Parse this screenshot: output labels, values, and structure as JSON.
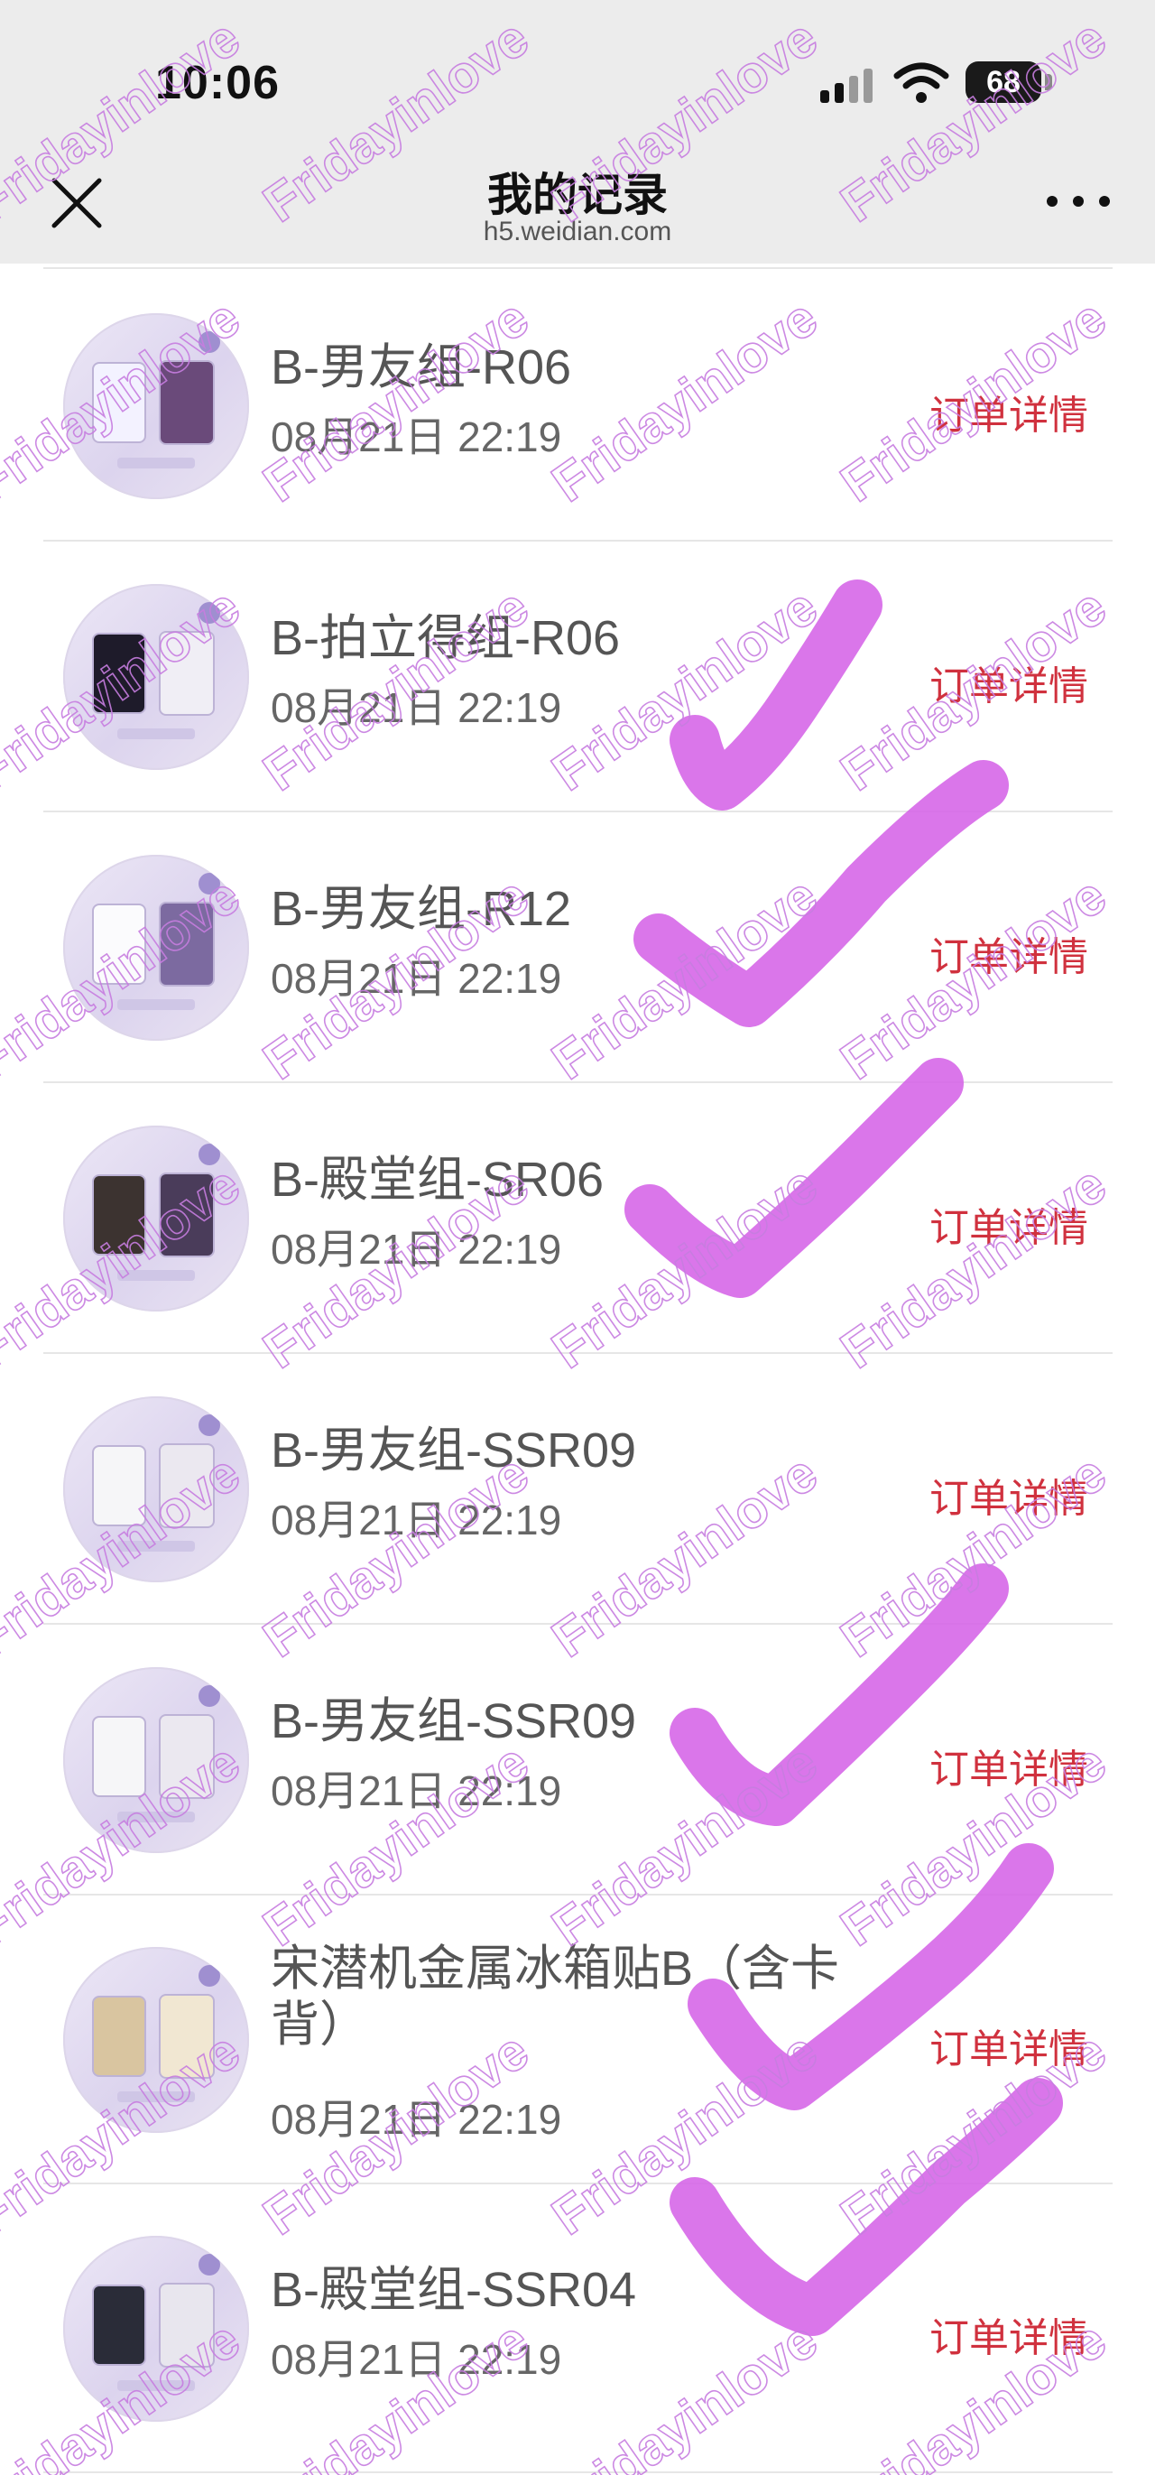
{
  "status_bar": {
    "time": "10:06",
    "battery_level": "68"
  },
  "nav": {
    "title": "我的记录",
    "subtitle": "h5.weidian.com"
  },
  "records": [
    {
      "name": "B-男友组-R06",
      "time": "08月21日 22:19",
      "action": "订单详情",
      "checked": false
    },
    {
      "name": "B-拍立得组-R06",
      "time": "08月21日 22:19",
      "action": "订单详情",
      "checked": true
    },
    {
      "name": "B-男友组-R12",
      "time": "08月21日 22:19",
      "action": "订单详情",
      "checked": true
    },
    {
      "name": "B-殿堂组-SR06",
      "time": "08月21日 22:19",
      "action": "订单详情",
      "checked": true
    },
    {
      "name": "B-男友组-SSR09",
      "time": "08月21日 22:19",
      "action": "订单详情",
      "checked": false
    },
    {
      "name": "B-男友组-SSR09",
      "time": "08月21日 22:19",
      "action": "订单详情",
      "checked": true
    },
    {
      "name": "宋潜机金属冰箱贴B（含卡背）",
      "time": "08月21日 22:19",
      "action": "订单详情",
      "checked": true
    },
    {
      "name": "B-殿堂组-SSR04",
      "time": "08月21日 22:19",
      "action": "订单详情",
      "checked": true
    }
  ],
  "watermark": {
    "text": "Fridayinlove",
    "color": "#c77de0"
  },
  "colors": {
    "link": "#d0313e",
    "check_mark": "#d45ee6",
    "chrome_bg": "#ececec"
  },
  "icons": {
    "close": "close-icon",
    "more": "more-icon",
    "signal": "cellular-signal-icon",
    "wifi": "wifi-icon",
    "battery": "battery-icon"
  }
}
